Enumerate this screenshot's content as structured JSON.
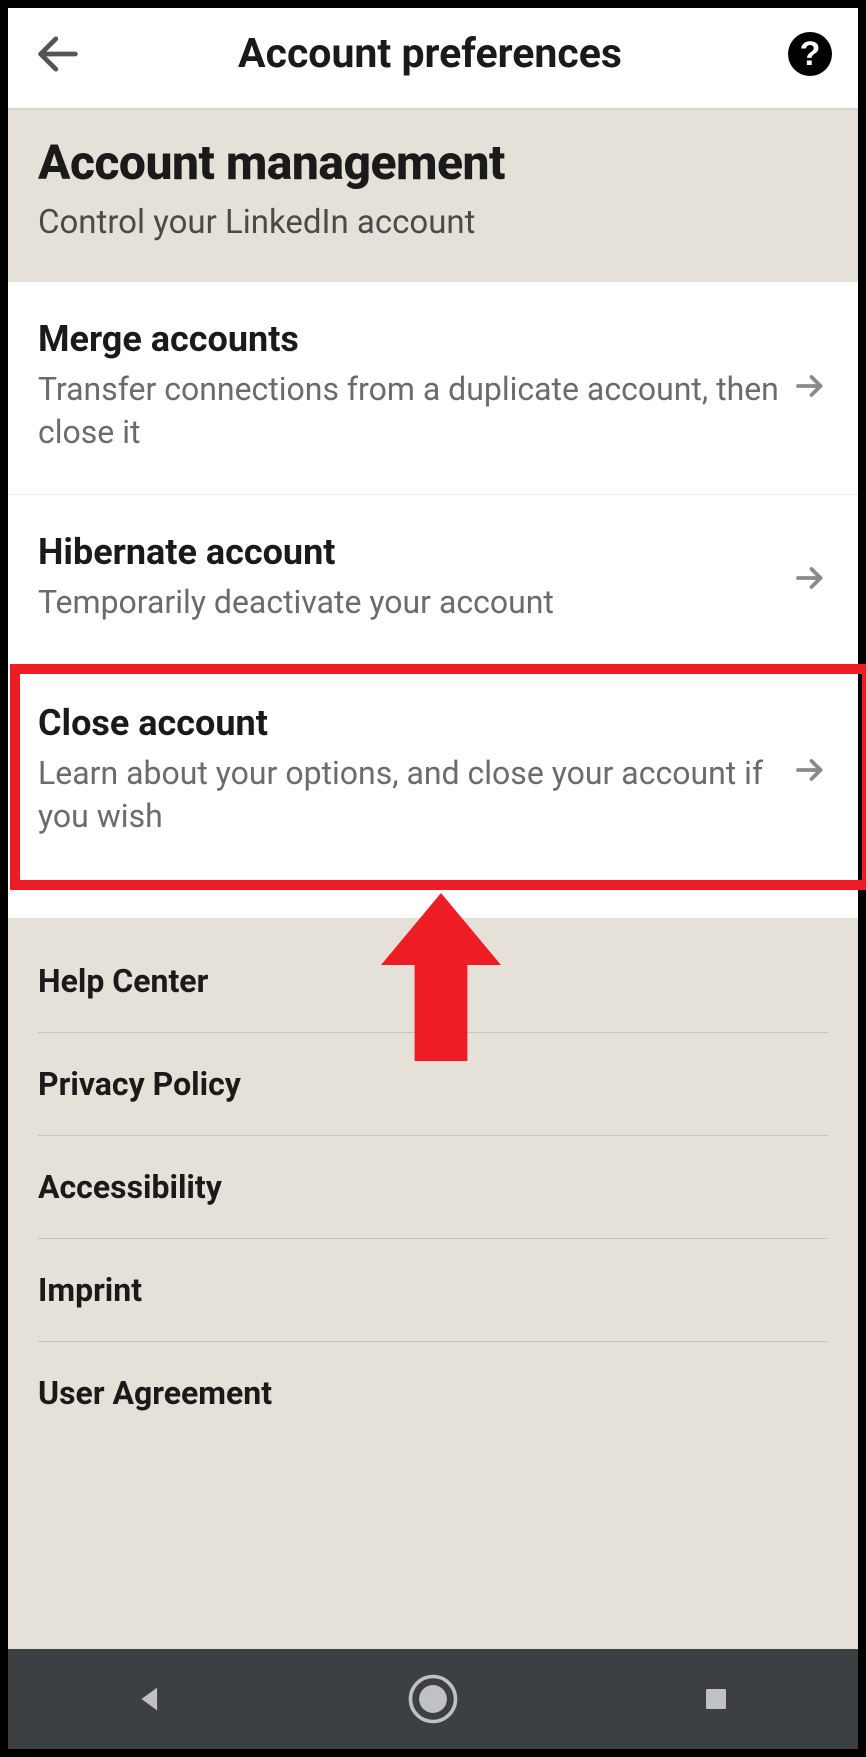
{
  "appbar": {
    "title": "Account preferences"
  },
  "section": {
    "title": "Account management",
    "subtitle": "Control your LinkedIn account"
  },
  "items": [
    {
      "title": "Merge accounts",
      "subtitle": "Transfer connections from a duplicate account, then close it"
    },
    {
      "title": "Hibernate account",
      "subtitle": "Temporarily deactivate your account"
    },
    {
      "title": "Close account",
      "subtitle": "Learn about your options, and close your account if you wish"
    }
  ],
  "footer_links": [
    "Help Center",
    "Privacy Policy",
    "Accessibility",
    "Imprint",
    "User Agreement"
  ],
  "annotation": {
    "highlighted_item_index": 2
  }
}
